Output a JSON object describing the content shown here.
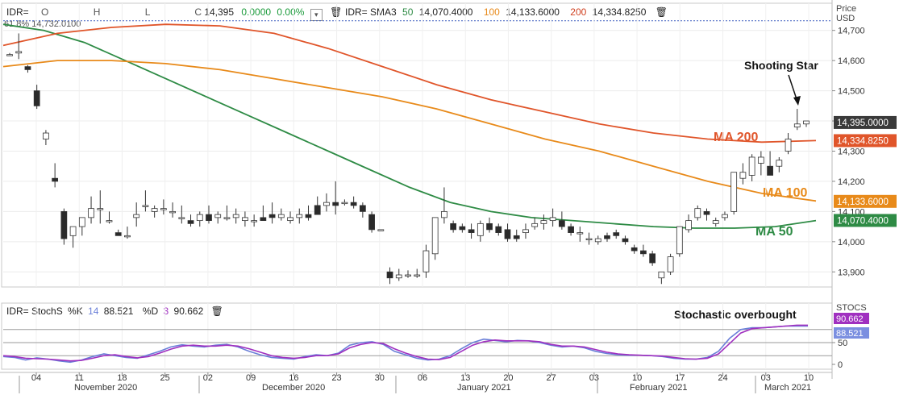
{
  "header": {
    "symbol": "IDR=",
    "open_label": "O",
    "high_label": "H",
    "low_label": "L",
    "close_label": "C",
    "close_value": "14,395",
    "change": "0.0000",
    "change_pct": "0.00%",
    "sma_label": "IDR= SMA3",
    "sma_periods": [
      "50",
      "100",
      "200"
    ],
    "sma_values": [
      "14,070.4000",
      "14,133.6000",
      "14,334.8250"
    ],
    "fib_label": "61.8%  14,732.0100"
  },
  "stoch_header": {
    "label": "IDR= StochS",
    "k_label": "%K",
    "k_period": "14",
    "k_value": "88.521",
    "d_label": "%D",
    "d_period": "3",
    "d_value": "90.662"
  },
  "annotations": {
    "shooting_star": "Shooting Star",
    "ma200": "MA 200",
    "ma100": "MA 100",
    "ma50": "MA 50",
    "stoch_overbought": "Stochastic overbought"
  },
  "price_axis": {
    "title_line1": "Price",
    "title_line2": "USD",
    "ticks": [
      "14,700",
      "14,600",
      "14,500",
      "14,400",
      "14,300",
      "14,200",
      "14,100",
      "14,000",
      "13,900"
    ],
    "last_price_tag": "14,395.0000",
    "tags": [
      "14,334.8250",
      "14,133.6000",
      "14,070.4000"
    ]
  },
  "stoch_axis": {
    "title": "STOCS",
    "ticks": [
      "50",
      "0"
    ],
    "tags": [
      "90.662",
      "88.521"
    ]
  },
  "x_axis": {
    "day_ticks": [
      "04",
      "11",
      "18",
      "25",
      "02",
      "09",
      "16",
      "23",
      "30",
      "06",
      "13",
      "20",
      "27",
      "03",
      "10",
      "17",
      "24",
      "03",
      "10"
    ],
    "month_labels": [
      "November 2020",
      "December 2020",
      "January 2021",
      "February 2021",
      "March 2021"
    ]
  },
  "colors": {
    "ma50": "#2e8b45",
    "ma100": "#e88a1a",
    "ma200": "#e0552a",
    "k_line": "#6a7fd8",
    "d_line": "#a030c0",
    "fib_line": "#4060c0",
    "last_tag": "#3a3a3a",
    "ma200_tag": "#e0552a",
    "ma100_tag": "#e88a1a",
    "ma50_tag": "#2e8b45",
    "d_tag": "#a030c0",
    "k_tag": "#7b8fe0",
    "change_green": "#1a9a3a",
    "sma_50_green": "#2e8b45",
    "sma_100_orange": "#e88a1a",
    "sma_200_red": "#d04020"
  },
  "chart_data": [
    {
      "type": "candlestick",
      "title": "",
      "ylabel": "Price USD",
      "ylim": [
        13850,
        14790
      ],
      "fib_level": {
        "label": "61.8%",
        "value": 14732.01
      },
      "candles": [
        [
          14620,
          14625,
          14620,
          14620
        ],
        [
          14625,
          14690,
          14605,
          14630
        ],
        [
          14580,
          14585,
          14560,
          14570
        ],
        [
          14500,
          14520,
          14440,
          14450
        ],
        [
          14340,
          14370,
          14320,
          14360
        ],
        [
          14210,
          14260,
          14180,
          14200
        ],
        [
          14100,
          14110,
          13990,
          14010
        ],
        [
          14020,
          14050,
          13980,
          14050
        ],
        [
          14050,
          14070,
          14020,
          14080
        ],
        [
          14080,
          14150,
          14060,
          14110
        ],
        [
          14110,
          14170,
          14060,
          14110
        ],
        [
          14070,
          14100,
          14060,
          14070
        ],
        [
          14030,
          14040,
          14020,
          14020
        ],
        [
          14020,
          14050,
          14010,
          14020
        ],
        [
          14080,
          14130,
          14050,
          14090
        ],
        [
          14120,
          14170,
          14100,
          14120
        ],
        [
          14100,
          14120,
          14080,
          14110
        ],
        [
          14110,
          14140,
          14090,
          14110
        ],
        [
          14100,
          14130,
          14080,
          14100
        ],
        [
          14080,
          14120,
          14060,
          14080
        ],
        [
          14070,
          14090,
          14050,
          14060
        ],
        [
          14070,
          14100,
          14050,
          14090
        ],
        [
          14090,
          14120,
          14060,
          14070
        ],
        [
          14080,
          14100,
          14060,
          14090
        ],
        [
          14080,
          14120,
          14070,
          14080
        ],
        [
          14080,
          14110,
          14060,
          14090
        ],
        [
          14070,
          14100,
          14050,
          14080
        ],
        [
          14070,
          14090,
          14050,
          14070
        ],
        [
          14080,
          14120,
          14070,
          14070
        ],
        [
          14090,
          14130,
          14060,
          14080
        ],
        [
          14080,
          14110,
          14070,
          14090
        ],
        [
          14070,
          14100,
          14060,
          14080
        ],
        [
          14080,
          14110,
          14060,
          14090
        ],
        [
          14090,
          14120,
          14070,
          14080
        ],
        [
          14120,
          14150,
          14100,
          14090
        ],
        [
          14120,
          14160,
          14100,
          14130
        ],
        [
          14130,
          14200,
          14090,
          14120
        ],
        [
          14130,
          14140,
          14120,
          14130
        ],
        [
          14130,
          14150,
          14110,
          14120
        ],
        [
          14120,
          14130,
          14080,
          14100
        ],
        [
          14090,
          14100,
          14030,
          14040
        ],
        [
          14040,
          14040,
          14040,
          14040
        ],
        [
          13900,
          13915,
          13860,
          13880
        ],
        [
          13880,
          13910,
          13870,
          13890
        ],
        [
          13890,
          13905,
          13880,
          13890
        ],
        [
          13890,
          13910,
          13880,
          13890
        ],
        [
          13900,
          13990,
          13880,
          13970
        ],
        [
          13960,
          14050,
          13940,
          14080
        ],
        [
          14080,
          14180,
          14060,
          14100
        ],
        [
          14060,
          14070,
          14030,
          14040
        ],
        [
          14050,
          14060,
          14030,
          14040
        ],
        [
          14040,
          14060,
          14010,
          14030
        ],
        [
          14020,
          14070,
          14000,
          14060
        ],
        [
          14060,
          14080,
          14030,
          14040
        ],
        [
          14050,
          14060,
          14020,
          14030
        ],
        [
          14040,
          14060,
          14000,
          14010
        ],
        [
          14020,
          14040,
          14000,
          14010
        ],
        [
          14030,
          14060,
          14010,
          14040
        ],
        [
          14050,
          14080,
          14040,
          14060
        ],
        [
          14060,
          14090,
          14040,
          14070
        ],
        [
          14070,
          14110,
          14050,
          14080
        ],
        [
          14070,
          14100,
          14040,
          14050
        ],
        [
          14050,
          14060,
          14020,
          14030
        ],
        [
          14030,
          14050,
          14000,
          14030
        ],
        [
          14010,
          14030,
          13990,
          14010
        ],
        [
          14000,
          14020,
          13990,
          14010
        ],
        [
          14020,
          14030,
          14000,
          14010
        ],
        [
          14030,
          14040,
          14010,
          14020
        ],
        [
          14010,
          14020,
          13990,
          14000
        ],
        [
          13980,
          13990,
          13960,
          13970
        ],
        [
          13970,
          13990,
          13950,
          13960
        ],
        [
          13960,
          13970,
          13920,
          13930
        ],
        [
          13880,
          13900,
          13860,
          13900
        ],
        [
          13900,
          13960,
          13890,
          13950
        ],
        [
          13960,
          14050,
          13950,
          14050
        ],
        [
          14040,
          14090,
          14030,
          14070
        ],
        [
          14080,
          14120,
          14070,
          14110
        ],
        [
          14100,
          14110,
          14070,
          14090
        ],
        [
          14060,
          14080,
          14050,
          14070
        ],
        [
          14080,
          14100,
          14070,
          14090
        ],
        [
          14100,
          14230,
          14090,
          14230
        ],
        [
          14210,
          14260,
          14190,
          14230
        ],
        [
          14220,
          14290,
          14200,
          14280
        ],
        [
          14260,
          14300,
          14220,
          14280
        ],
        [
          14250,
          14300,
          14230,
          14220
        ],
        [
          14250,
          14280,
          14230,
          14270
        ],
        [
          14300,
          14360,
          14290,
          14340
        ],
        [
          14380,
          14440,
          14370,
          14390
        ],
        [
          14390,
          14400,
          14380,
          14400
        ]
      ],
      "series": [
        {
          "name": "MA 50",
          "values": [
            14720,
            14700,
            14660,
            14600,
            14540,
            14480,
            14420,
            14360,
            14300,
            14240,
            14180,
            14130,
            14100,
            14080,
            14070,
            14060,
            14050,
            14045,
            14045,
            14050,
            14070
          ]
        },
        {
          "name": "MA 100",
          "values": [
            14580,
            14600,
            14600,
            14590,
            14570,
            14540,
            14510,
            14480,
            14440,
            14390,
            14340,
            14300,
            14250,
            14200,
            14160,
            14135
          ]
        },
        {
          "name": "MA 200",
          "values": [
            14650,
            14690,
            14710,
            14720,
            14715,
            14690,
            14640,
            14580,
            14520,
            14470,
            14430,
            14390,
            14360,
            14340,
            14330,
            14335
          ]
        }
      ]
    },
    {
      "type": "line",
      "title": "",
      "ylabel": "STOCS",
      "ylim": [
        0,
        100
      ],
      "levels": [
        20,
        50,
        80
      ],
      "series": [
        {
          "name": "%K",
          "values": [
            18,
            16,
            10,
            15,
            12,
            8,
            5,
            10,
            18,
            24,
            20,
            16,
            14,
            22,
            30,
            40,
            45,
            42,
            40,
            44,
            46,
            40,
            30,
            22,
            16,
            14,
            12,
            18,
            22,
            20,
            26,
            44,
            50,
            52,
            46,
            30,
            22,
            14,
            10,
            12,
            20,
            36,
            50,
            58,
            55,
            52,
            55,
            54,
            50,
            44,
            40,
            42,
            38,
            30,
            25,
            22,
            21,
            21,
            20,
            18,
            14,
            12,
            12,
            16,
            30,
            60,
            80,
            84,
            84,
            86,
            88,
            88,
            88
          ]
        },
        {
          "name": "%D",
          "values": [
            20,
            18,
            14,
            13,
            12,
            10,
            8,
            9,
            14,
            20,
            22,
            18,
            15,
            18,
            26,
            35,
            42,
            44,
            42,
            42,
            44,
            42,
            36,
            28,
            20,
            16,
            14,
            16,
            20,
            20,
            24,
            38,
            46,
            50,
            48,
            36,
            26,
            18,
            12,
            11,
            16,
            30,
            44,
            52,
            56,
            54,
            54,
            54,
            52,
            46,
            42,
            42,
            40,
            34,
            28,
            24,
            22,
            21,
            20,
            19,
            16,
            13,
            12,
            14,
            24,
            48,
            72,
            82,
            84,
            86,
            88,
            90,
            90
          ]
        }
      ]
    }
  ]
}
